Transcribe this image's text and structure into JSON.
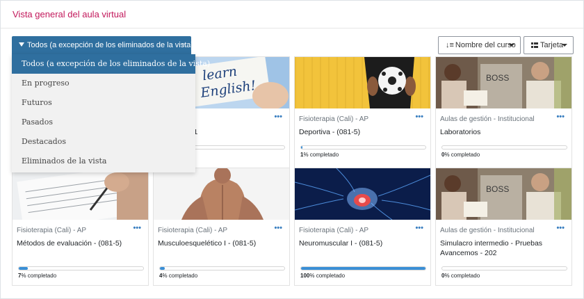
{
  "block": {
    "title": "Vista general del aula virtual"
  },
  "filter": {
    "selected": "Todos (a excepción de los eliminados de la vista)",
    "options": [
      "Todos (a excepción de los eliminados de la vista)",
      "En progreso",
      "Futuros",
      "Pasados",
      "Destacados",
      "Eliminados de la vista"
    ]
  },
  "sort": {
    "label": "Nombre del curso",
    "icon": "sort-icon"
  },
  "view": {
    "label": "Tarjeta",
    "icon": "grid-icon"
  },
  "menu_glyph": "•••",
  "completed_suffix": "% completado",
  "colors": {
    "accent": "#2f6f9f",
    "title": "#c2185b",
    "progress": "#3a8fd6"
  },
  "courses": [
    {
      "category": "",
      "name": "lés A1+_211",
      "percent": 0,
      "pct_text": "",
      "suffix_text": "do",
      "image": "learn-english-card-image"
    },
    {
      "category": "Fisioterapia (Cali) - AP",
      "name": "Deportiva - (081-5)",
      "percent": 1,
      "pct_text": "1",
      "image": "soccer-ball-image"
    },
    {
      "category": "Aulas de gestión - Institucional",
      "name": "Laboratorios",
      "percent": 0,
      "pct_text": "0",
      "image": "students-reading-image"
    },
    {
      "category": "Fisioterapia (Cali) - AP",
      "name": "Métodos de evaluación - (081-5)",
      "percent": 7,
      "pct_text": "7",
      "image": "writing-form-image"
    },
    {
      "category": "Fisioterapia (Cali) - AP",
      "name": "Musculoesquelético I - (081-5)",
      "percent": 4,
      "pct_text": "4",
      "image": "back-muscles-image"
    },
    {
      "category": "Fisioterapia (Cali) - AP",
      "name": "Neuromuscular I - (081-5)",
      "percent": 100,
      "pct_text": "100",
      "image": "brain-neurons-image"
    },
    {
      "category": "Aulas de gestión - Institucional",
      "name": "Simulacro intermedio - Pruebas Avancemos - 202",
      "percent": 0,
      "pct_text": "0",
      "image": "students-reading-image"
    }
  ]
}
